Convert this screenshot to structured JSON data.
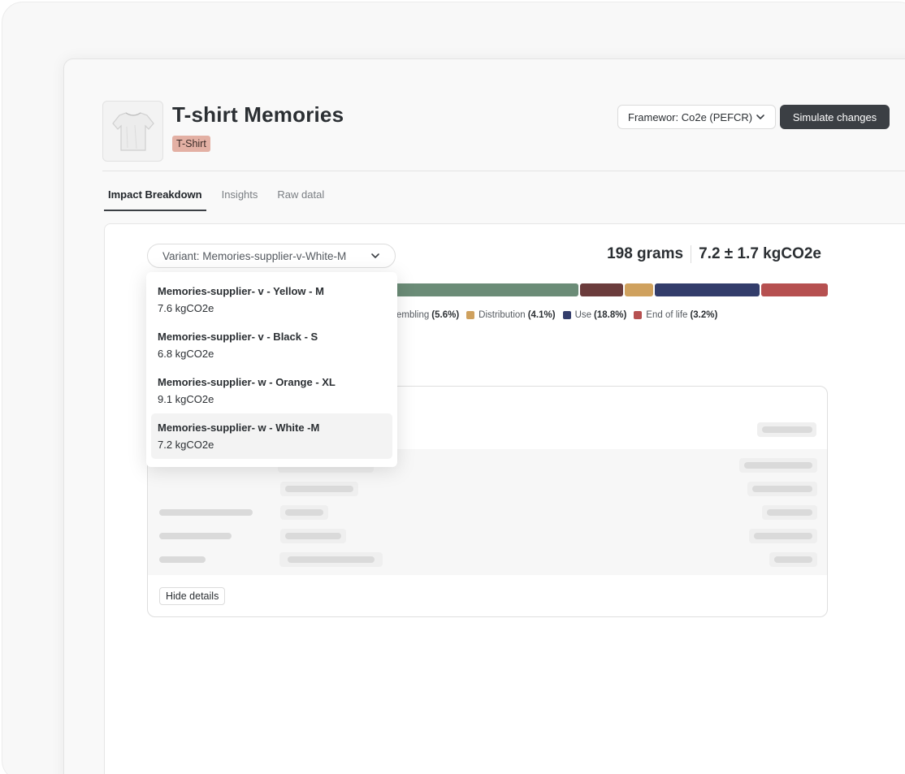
{
  "product": {
    "title": "T-shirt Memories",
    "badge": "T-Shirt",
    "image_icon": "tshirt-icon"
  },
  "header": {
    "framework_select": "Framewor: Co2e (PEFCR)",
    "simulate_button": "Simulate changes"
  },
  "tabs": [
    {
      "label": "Impact Breakdown",
      "active": true
    },
    {
      "label": "Insights",
      "active": false
    },
    {
      "label": "Raw datal",
      "active": false
    }
  ],
  "variant_select": "Variant: Memories-supplier-v-White-M",
  "totals": {
    "weight": "198 grams",
    "emissions": "7.2 ± 1.7 kgCO2e"
  },
  "breakdown": {
    "colors": {
      "assembling": "#6b8c77",
      "maroon": "#6b3c3c",
      "distribution": "#cfa15e",
      "use": "#333d6b",
      "end_of_life": "#b65050"
    },
    "legend": [
      {
        "label": "embling",
        "value": "(5.6%)",
        "color": "#6b8c77",
        "swatch": false
      },
      {
        "label": "Distribution",
        "value": "(4.1%)",
        "color": "#cfa15e",
        "swatch": true
      },
      {
        "label": "Use",
        "value": "(18.8%)",
        "color": "#333d6b",
        "swatch": true
      },
      {
        "label": "End of life",
        "value": "(3.2%)",
        "color": "#b65050",
        "swatch": true
      }
    ]
  },
  "details": {
    "hide_button": "Hide details"
  },
  "dropdown": {
    "options": [
      {
        "name": "Memories-supplier- v - Yellow - M",
        "value": "7.6 kgCO2e",
        "selected": false
      },
      {
        "name": "Memories-supplier- v - Black - S",
        "value": "6.8 kgCO2e",
        "selected": false
      },
      {
        "name": "Memories-supplier- w - Orange - XL",
        "value": "9.1 kgCO2e",
        "selected": false
      },
      {
        "name": "Memories-supplier- w - White -M",
        "value": "7.2 kgCO2e",
        "selected": true
      }
    ]
  }
}
